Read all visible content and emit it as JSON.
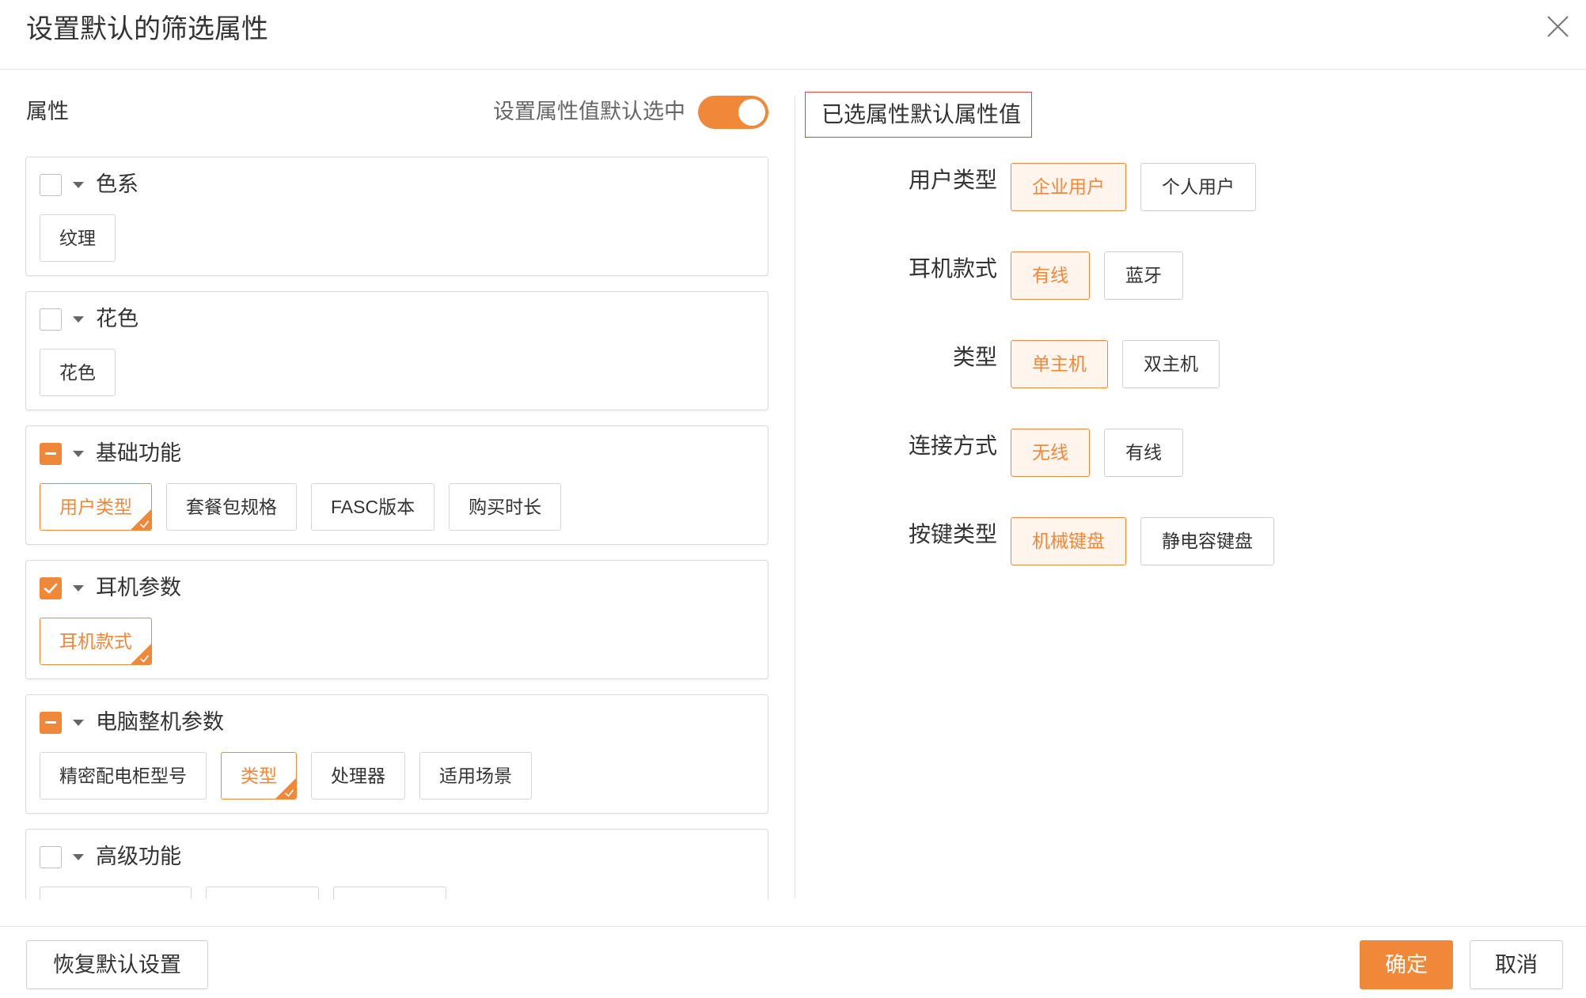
{
  "colors": {
    "accent": "#f0883a",
    "accent_light": "#fff5ec",
    "highlight_border": "#e5443b"
  },
  "icons": {
    "close": "close-icon",
    "caret": "caret-down-icon",
    "check": "check-icon",
    "indeterminate": "minus-icon"
  },
  "dialog": {
    "title": "设置默认的筛选属性"
  },
  "left": {
    "heading": "属性",
    "toggle_label": "设置属性值默认选中",
    "toggle_on": true,
    "groups": [
      {
        "label": "色系",
        "checked": false,
        "indeterminate": false,
        "tags": [
          {
            "label": "纹理",
            "selected": false
          }
        ]
      },
      {
        "label": "花色",
        "checked": false,
        "indeterminate": false,
        "tags": [
          {
            "label": "花色",
            "selected": false
          }
        ]
      },
      {
        "label": "基础功能",
        "checked": false,
        "indeterminate": true,
        "tags": [
          {
            "label": "用户类型",
            "selected": true
          },
          {
            "label": "套餐包规格",
            "selected": false
          },
          {
            "label": "FASC版本",
            "selected": false
          },
          {
            "label": "购买时长",
            "selected": false
          }
        ]
      },
      {
        "label": "耳机参数",
        "checked": true,
        "indeterminate": false,
        "tags": [
          {
            "label": "耳机款式",
            "selected": true
          }
        ]
      },
      {
        "label": "电脑整机参数",
        "checked": false,
        "indeterminate": true,
        "tags": [
          {
            "label": "精密配电柜型号",
            "selected": false
          },
          {
            "label": "类型",
            "selected": true
          },
          {
            "label": "处理器",
            "selected": false
          },
          {
            "label": "适用场景",
            "selected": false
          }
        ]
      },
      {
        "label": "高级功能",
        "checked": false,
        "indeterminate": false
      }
    ]
  },
  "right": {
    "heading": "已选属性默认属性值",
    "rows": [
      {
        "label": "用户类型",
        "options": [
          {
            "label": "企业用户",
            "selected": true
          },
          {
            "label": "个人用户",
            "selected": false
          }
        ]
      },
      {
        "label": "耳机款式",
        "options": [
          {
            "label": "有线",
            "selected": true
          },
          {
            "label": "蓝牙",
            "selected": false
          }
        ]
      },
      {
        "label": "类型",
        "options": [
          {
            "label": "单主机",
            "selected": true
          },
          {
            "label": "双主机",
            "selected": false
          }
        ]
      },
      {
        "label": "连接方式",
        "options": [
          {
            "label": "无线",
            "selected": true
          },
          {
            "label": "有线",
            "selected": false
          }
        ]
      },
      {
        "label": "按键类型",
        "options": [
          {
            "label": "机械键盘",
            "selected": true
          },
          {
            "label": "静电容键盘",
            "selected": false
          }
        ]
      }
    ]
  },
  "footer": {
    "reset_label": "恢复默认设置",
    "confirm_label": "确定",
    "cancel_label": "取消"
  }
}
